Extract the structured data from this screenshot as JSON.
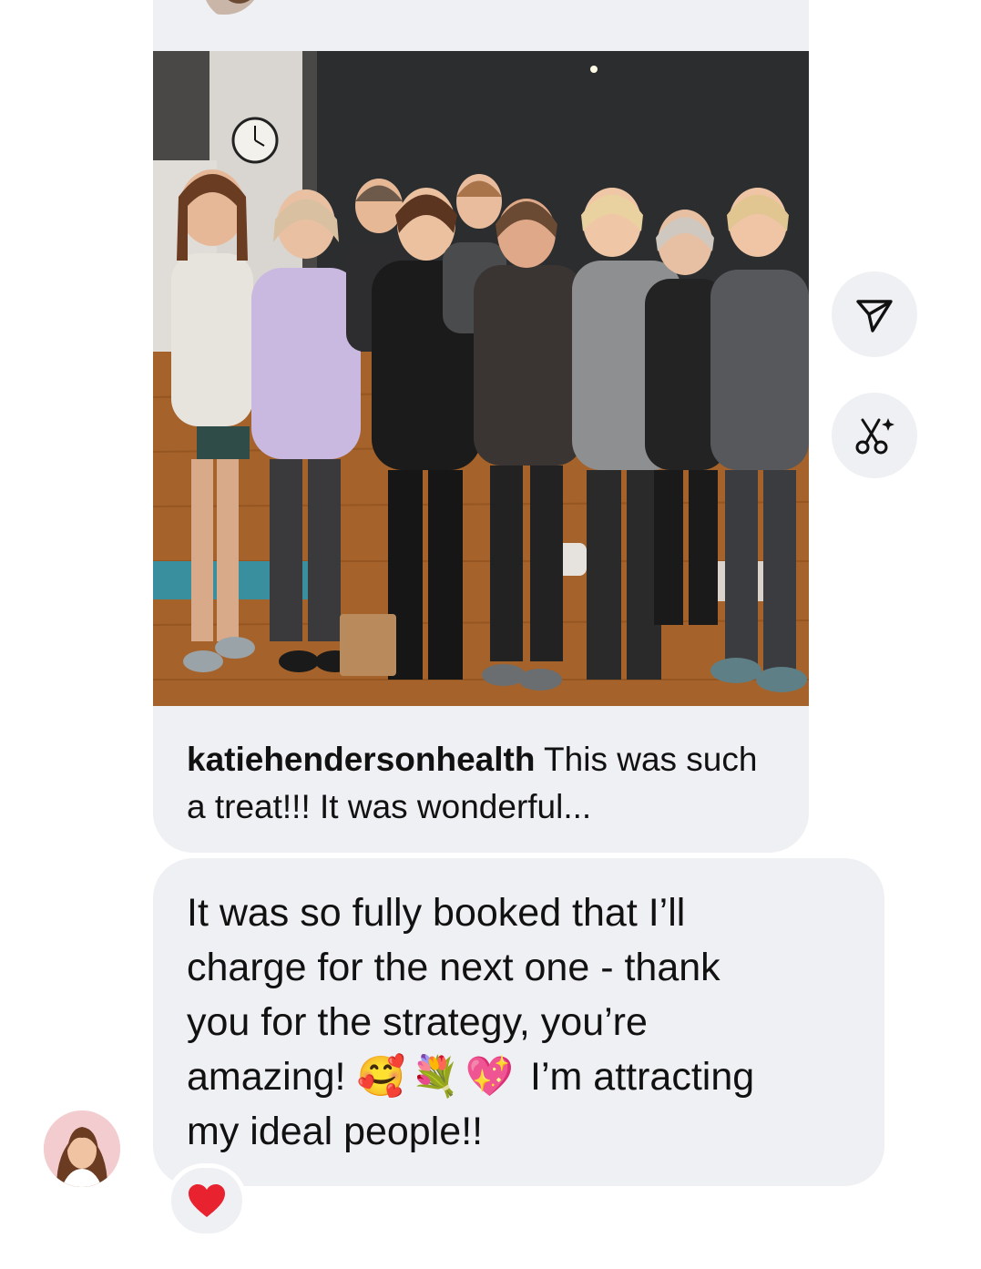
{
  "conversation": {
    "shared_post": {
      "username": "katiehendersonhealth",
      "caption": " This was such a treat!!! It was wonderful...",
      "photo_icon": "group-photo"
    },
    "actions": {
      "share_icon": "send-icon",
      "ai_icon": "sparkle-scissors-icon"
    },
    "message": {
      "line1": "It was so fully booked that I’ll",
      "line2": "charge for the next one - thank",
      "line3": "you for the strategy, you’re",
      "line4_pre": "amazing! ",
      "emojis": "🥰💐💖",
      "line4_post": " I’m attracting",
      "line5": "my ideal people!!"
    },
    "reaction": {
      "emoji": "❤️"
    },
    "colors": {
      "bubble": "#eef0f3",
      "heart": "#e8232f"
    }
  }
}
